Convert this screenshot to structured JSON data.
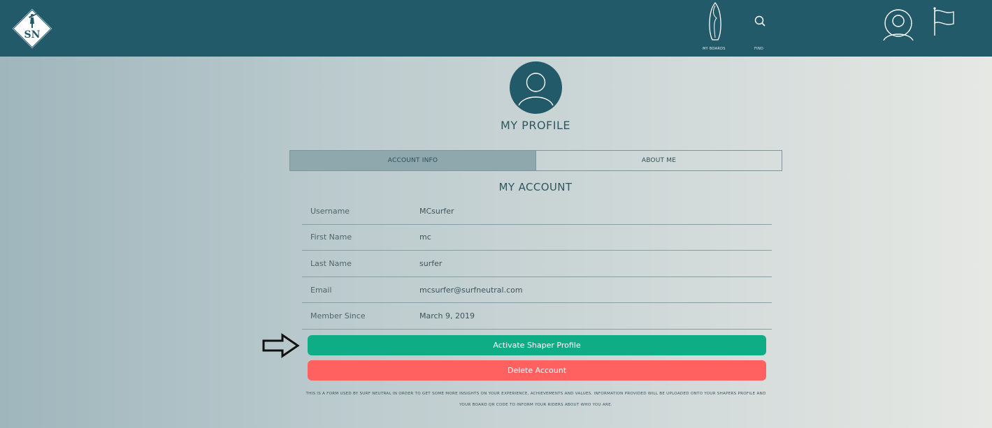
{
  "brand": {
    "logo_text": "SN"
  },
  "nav": {
    "my_boards_label": "MY BOARDS",
    "find_label": "FIND"
  },
  "profile": {
    "title": "MY PROFILE"
  },
  "tabs": [
    {
      "label": "ACCOUNT INFO",
      "active": true
    },
    {
      "label": "ABOUT ME",
      "active": false
    }
  ],
  "account": {
    "title": "MY ACCOUNT",
    "rows": [
      {
        "label": "Username",
        "value": "MCsurfer"
      },
      {
        "label": "First Name",
        "value": "mc"
      },
      {
        "label": "Last Name",
        "value": "surfer"
      },
      {
        "label": "Email",
        "value": "mcsurfer@surfneutral.com"
      },
      {
        "label": "Member Since",
        "value": "March 9, 2019"
      }
    ]
  },
  "buttons": {
    "activate_label": "Activate Shaper Profile",
    "delete_label": "Delete Account"
  },
  "note": {
    "line1": "THIS IS A FORM USED BY SURF NEUTRAL IN ORDER TO GET SOME MORE INSIGHTS ON YOUR EXPERIENCE, ACHIEVEMENTS AND VALUES. INFORMATION PROVIDED WILL BE UPLOADED ONTO YOUR SHAPERS PROFILE AND",
    "line2": "YOUR BOARD QR CODE TO INFORM YOUR RIDERS ABOUT WHO YOU ARE."
  },
  "colors": {
    "topbar": "#235a6a",
    "activate": "#0fad86",
    "delete": "#ff6060",
    "tab_active": "#8ea8ad"
  }
}
